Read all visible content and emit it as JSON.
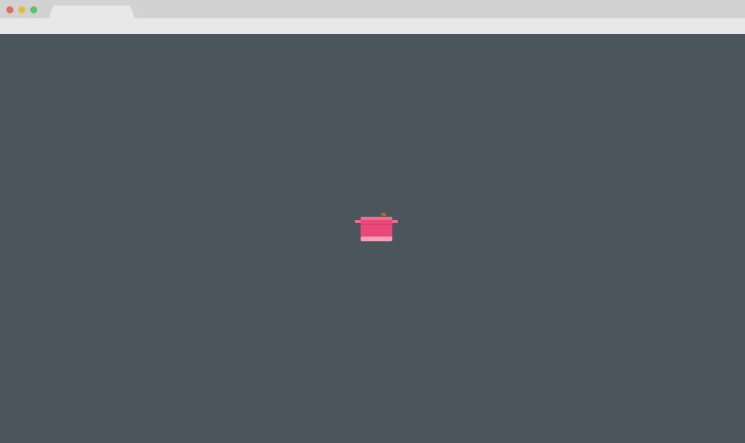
{
  "window": {
    "tab_title": "",
    "colors": {
      "titlebar": "#d2d2d2",
      "toolbar": "#e8e8e8",
      "tab": "#e8e8e8",
      "background": "#4b565c"
    },
    "traffic_lights": [
      {
        "name": "close",
        "color": "#e06c60"
      },
      {
        "name": "minimize",
        "color": "#e0be45"
      },
      {
        "name": "maximize",
        "color": "#5cc46c"
      }
    ]
  },
  "scene": {
    "object": {
      "icon": "cooking-pot-icon",
      "body_color": "#e9497a",
      "rim_color": "#f06a92",
      "base_color": "#f5a0b5",
      "knob_color": "#b5651d"
    }
  }
}
